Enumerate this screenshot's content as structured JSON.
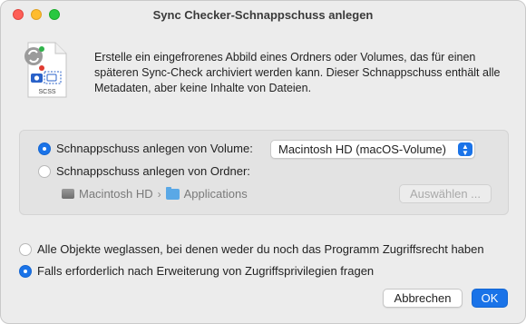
{
  "window": {
    "title": "Sync Checker-Schnappschuss anlegen"
  },
  "document_icon": {
    "label": "SCSS"
  },
  "intro_text": "Erstelle ein eingefrorenes Abbild eines Ordners oder Volumes, das für einen späteren Sync-Check archiviert werden kann. Dieser Schnappschuss enthält alle Metadaten, aber keine Inhalte von Dateien.",
  "source": {
    "volume_option": {
      "label": "Schnappschuss anlegen von Volume:",
      "selected": true
    },
    "volume_select": {
      "value": "Macintosh HD (macOS-Volume)"
    },
    "folder_option": {
      "label": "Schnappschuss anlegen von Ordner:",
      "selected": false
    },
    "path": {
      "volume": "Macintosh HD",
      "separator": "›",
      "folder": "Applications"
    },
    "choose_button": {
      "label": "Auswählen ..."
    }
  },
  "access": {
    "omit_option": {
      "label": "Alle Objekte weglassen, bei denen weder du noch das Programm Zugriffsrecht haben",
      "selected": false
    },
    "ask_option": {
      "label": "Falls erforderlich nach Erweiterung von Zugriffsprivilegien fragen",
      "selected": true
    }
  },
  "buttons": {
    "cancel": "Abbrechen",
    "ok": "OK"
  },
  "colors": {
    "accent": "#1a73e8",
    "window_bg": "#ececec"
  }
}
